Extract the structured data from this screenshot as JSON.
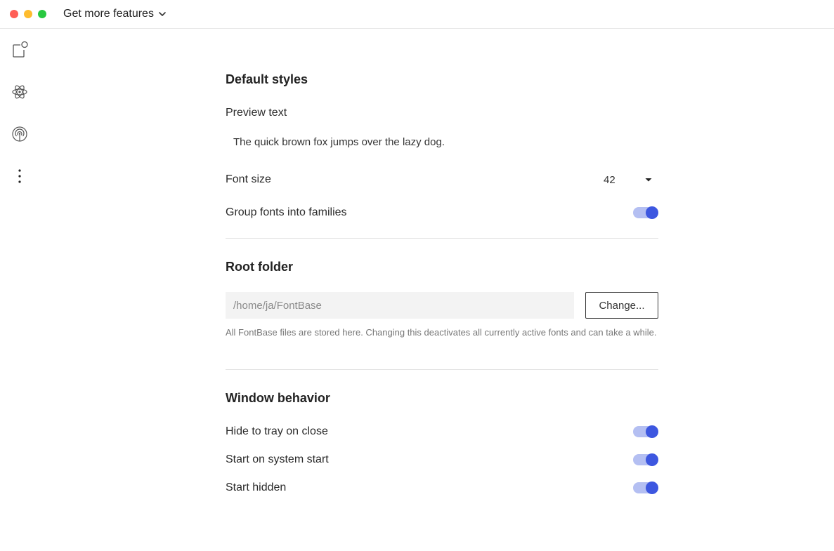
{
  "titlebar": {
    "features_label": "Get more features"
  },
  "sidebar": {
    "items": [
      {
        "icon": "fonts-icon"
      },
      {
        "icon": "atom-icon"
      },
      {
        "icon": "broadcast-icon"
      },
      {
        "icon": "more-vertical-icon"
      }
    ]
  },
  "default_styles": {
    "heading": "Default styles",
    "preview_label": "Preview text",
    "preview_value": "The quick brown fox jumps over the lazy dog.",
    "font_size_label": "Font size",
    "font_size_value": "42",
    "group_label": "Group fonts into families",
    "group_enabled": true
  },
  "root_folder": {
    "heading": "Root folder",
    "path_value": "/home/ja/FontBase",
    "change_label": "Change...",
    "hint": "All FontBase files are stored here. Changing this deactivates all currently active fonts and can take a while."
  },
  "window_behavior": {
    "heading": "Window behavior",
    "hide_tray_label": "Hide to tray on close",
    "hide_tray_enabled": true,
    "start_system_label": "Start on system start",
    "start_system_enabled": true,
    "start_hidden_label": "Start hidden",
    "start_hidden_enabled": true
  },
  "colors": {
    "accent": "#3d57e0",
    "accent_track": "#b4bff2"
  }
}
